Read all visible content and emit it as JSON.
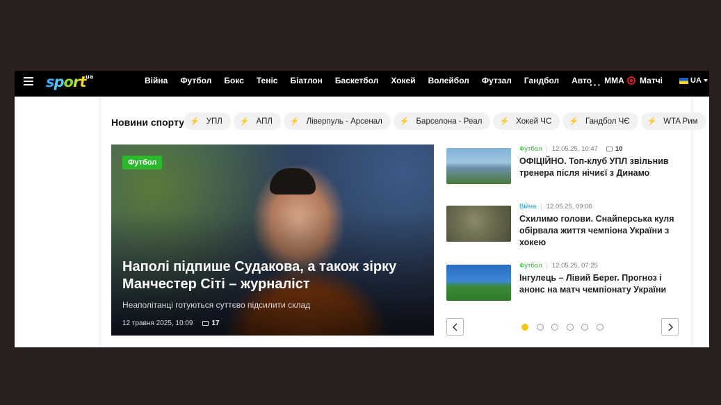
{
  "nav": {
    "logo": {
      "text": "sport",
      "suffix": "ua"
    },
    "links": [
      "Війна",
      "Футбол",
      "Бокс",
      "Теніс",
      "Біатлон",
      "Баскетбол",
      "Хокей",
      "Волейбол",
      "Футзал",
      "Гандбол",
      "Авто",
      "MMA"
    ],
    "more": "···",
    "matches": "Матчі",
    "lang": "UA"
  },
  "news": {
    "title": "Новини спорту",
    "tags": [
      "УПЛ",
      "АПЛ",
      "Ліверпуль - Арсенал",
      "Барселона - Реал",
      "Хокей ЧС",
      "Гандбол ЧЄ",
      "WTA Рим"
    ]
  },
  "hero": {
    "badge": "Футбол",
    "headline": "Наполі підпише Судакова, а також зірку Манчестер Сіті – журналіст",
    "subtitle": "Неаполітанці готуються суттєво підсилити склад",
    "date": "12 травня 2025, 10:09",
    "comments": "17"
  },
  "side_items": [
    {
      "category": "Футбол",
      "category_color": "#2eb82e",
      "date": "12.05.25, 10:47",
      "comments": "10",
      "title": "ОФІЦІЙНО. Топ-клуб УПЛ звільнив тренера після нічиєї з Динамо"
    },
    {
      "category": "Війна",
      "category_color": "#1a9fd8",
      "date": "12.05.25, 09:00",
      "comments": "",
      "title": "Схилимо голови. Снайперська куля обірвала життя чемпіона України з хокею"
    },
    {
      "category": "Футбол",
      "category_color": "#2eb82e",
      "date": "12.05.25, 07:25",
      "comments": "",
      "title": "Інгулець – Лівий Берег. Прогноз і анонс на матч чемпіонату України"
    }
  ],
  "carousel": {
    "pages": 6,
    "active": 1
  },
  "colors": {
    "accent": "#f5c518",
    "football": "#2eb82e",
    "war": "#1a9fd8"
  }
}
